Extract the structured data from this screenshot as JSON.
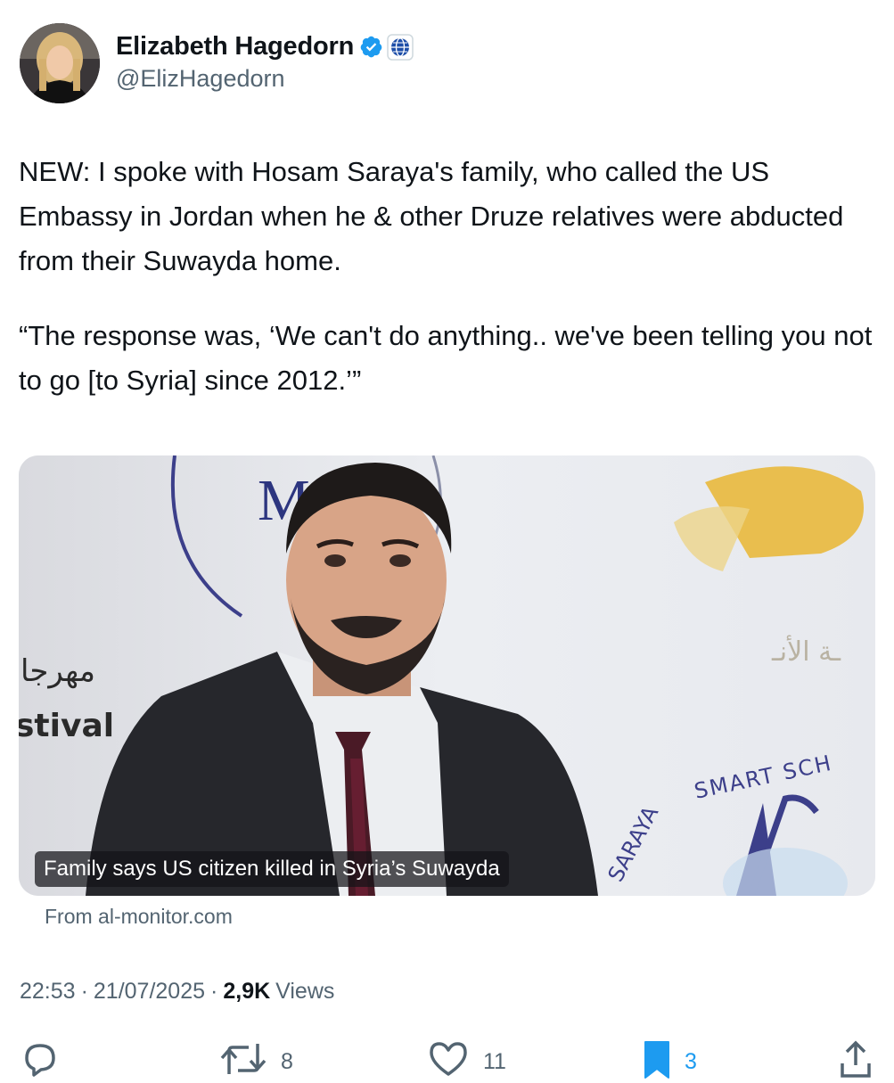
{
  "author": {
    "display_name": "Elizabeth Hagedorn",
    "handle": "@ElizHagedorn",
    "verified_icon": "verified-badge-icon",
    "affiliation_icon": "globe-icon"
  },
  "tweet": {
    "paragraph_1": "NEW: I spoke with Hosam Saraya's family, who called the US Embassy in Jordan when he & other Druze relatives were abducted from their Suwayda home.",
    "paragraph_2": "“The response was, ‘We can't do anything.. we've been telling you not to go [to Syria] since 2012.’”"
  },
  "card": {
    "caption": "Family says US citizen killed in Syria’s Suwayda",
    "source": "From al-monitor.com"
  },
  "meta": {
    "time": "22:53",
    "date": "21/07/2025",
    "views_count": "2,9K",
    "views_label": "Views",
    "separator": "·"
  },
  "actions": {
    "reply_count": "",
    "retweet_count": "8",
    "like_count": "11",
    "bookmark_count": "3"
  },
  "colors": {
    "accent": "#1d9bf0",
    "text": "#0f1419",
    "secondary": "#536471"
  }
}
